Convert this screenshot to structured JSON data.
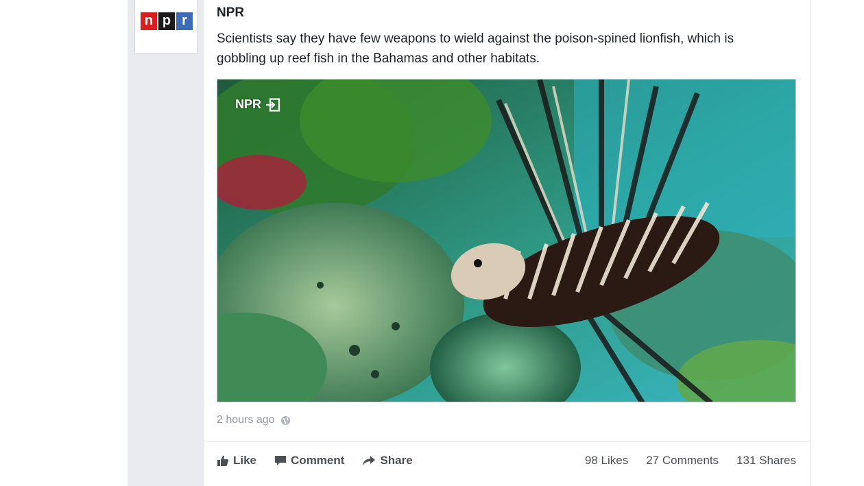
{
  "post": {
    "page_name": "NPR",
    "text": "Scientists say they have few weapons to wield against the poison-spined lionfish, which is gobbling up reef fish in the Bahamas and other habitats.",
    "avatar_logo": {
      "n": "n",
      "p": "p",
      "r": "r"
    },
    "media_badge": "NPR",
    "timestamp": "2 hours ago"
  },
  "actions": {
    "like": "Like",
    "comment": "Comment",
    "share": "Share"
  },
  "stats": {
    "likes": "98 Likes",
    "comments": "27 Comments",
    "shares": "131 Shares"
  },
  "colors": {
    "npr_red": "#d62021",
    "npr_black": "#1b1b1b",
    "npr_blue": "#3b6cb4",
    "feed_background": "#e9ebee"
  }
}
